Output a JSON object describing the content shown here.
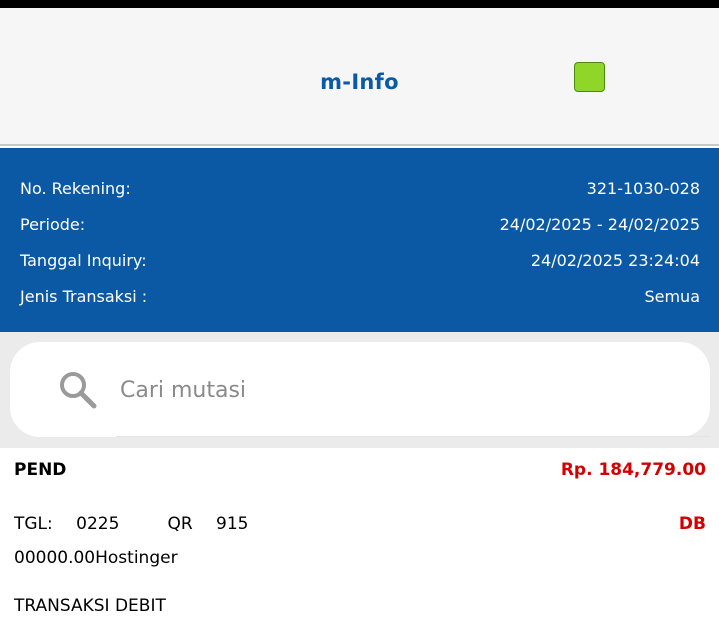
{
  "header": {
    "title": "m-Info",
    "accent_color": "#8fd629"
  },
  "info": {
    "rows": [
      {
        "label": "No. Rekening:",
        "value": "321-1030-028"
      },
      {
        "label": "Periode:",
        "value": "24/02/2025 - 24/02/2025"
      },
      {
        "label": "Tanggal Inquiry:",
        "value": "24/02/2025 23:24:04"
      },
      {
        "label": "Jenis Transaksi :",
        "value": "Semua"
      }
    ],
    "background_color": "#0b58a4"
  },
  "search": {
    "placeholder": "Cari mutasi",
    "icon": "search-icon"
  },
  "transaction": {
    "status": "PEND",
    "amount": "Rp. 184,779.00",
    "date_label": "TGL: 0225",
    "reference": "QR 915",
    "type": "DB",
    "description": "00000.00Hostinger",
    "category": "TRANSAKSI DEBIT",
    "amount_color": "#d40000"
  }
}
